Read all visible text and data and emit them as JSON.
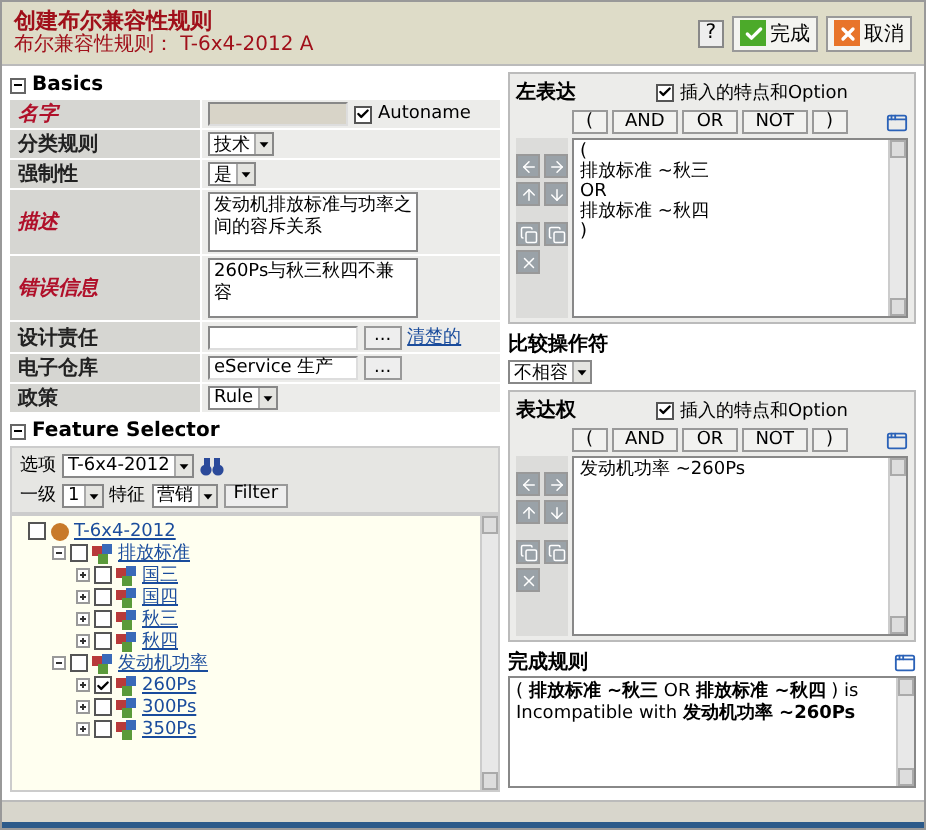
{
  "header": {
    "title": "创建布尔兼容性规则",
    "subtitle": "布尔兼容性规则： T-6x4-2012 A",
    "help": "?",
    "buttons": [
      {
        "label": "完成",
        "kind": "ok"
      },
      {
        "label": "取消",
        "kind": "cancel"
      }
    ]
  },
  "basics": {
    "title": "Basics",
    "expanded": true,
    "fields": [
      {
        "label": "名字",
        "required": true,
        "kind": "text",
        "checkbox": {
          "label": "Autoname",
          "checked": true
        }
      },
      {
        "label": "分类规则",
        "required": false,
        "kind": "select",
        "value": "技术"
      },
      {
        "label": "强制性",
        "required": false,
        "kind": "select",
        "value": "是"
      },
      {
        "label": "描述",
        "required": true,
        "kind": "textarea",
        "value": "发动机排放标准与功率之间的容斥关系"
      },
      {
        "label": "错误信息",
        "required": true,
        "kind": "textarea",
        "value": "260Ps与秋三秋四不兼容"
      },
      {
        "label": "设计责任",
        "required": false,
        "kind": "picker",
        "button": "...",
        "link": "清楚的"
      },
      {
        "label": "电子仓库",
        "required": false,
        "kind": "picker",
        "value": "eService 生产",
        "button": "..."
      },
      {
        "label": "政策",
        "required": false,
        "kind": "select",
        "value": "Rule"
      }
    ]
  },
  "feature_selector": {
    "title": "Feature Selector",
    "expanded": true,
    "option_label": "选项",
    "option_value": "T-6x4-2012",
    "level_label": "一级",
    "level_value": "1",
    "feature_label": "特征",
    "feature_value": "营销",
    "filter_button": "Filter",
    "tree": [
      {
        "label": "T-6x4-2012",
        "checked": false,
        "children": [
          {
            "label": "排放标准",
            "checked": false,
            "expanded": true,
            "children": [
              {
                "label": "国三",
                "checked": false,
                "expanded": false
              },
              {
                "label": "国四",
                "checked": false,
                "expanded": false
              },
              {
                "label": "秋三",
                "checked": false,
                "expanded": false
              },
              {
                "label": "秋四",
                "checked": false,
                "expanded": false
              }
            ]
          },
          {
            "label": "发动机功率",
            "checked": false,
            "expanded": true,
            "children": [
              {
                "label": "260Ps",
                "checked": true,
                "expanded": false
              },
              {
                "label": "300Ps",
                "checked": false,
                "expanded": false
              },
              {
                "label": "350Ps",
                "checked": false,
                "expanded": false
              }
            ]
          }
        ]
      }
    ]
  },
  "left_expression": {
    "title": "左表达",
    "insert_checkbox": {
      "label": "插入的特点和Option",
      "checked": true
    },
    "operators": [
      "(",
      "AND",
      "OR",
      "NOT",
      ")"
    ],
    "lines": [
      "(",
      "排放标准 ~秋三",
      "OR",
      "排放标准 ~秋四",
      ")"
    ]
  },
  "comparison": {
    "title": "比较操作符",
    "value": "不相容"
  },
  "right_expression": {
    "title": "表达权",
    "insert_checkbox": {
      "label": "插入的特点和Option",
      "checked": true
    },
    "operators": [
      "(",
      "AND",
      "OR",
      "NOT",
      ")"
    ],
    "lines": [
      "发动机功率 ~260Ps"
    ]
  },
  "result": {
    "title": "完成规则",
    "text": "( **排放标准 ~秋三** OR **排放标准 ~秋四** ) is Incompatible with **发动机功率 ~260Ps**"
  }
}
